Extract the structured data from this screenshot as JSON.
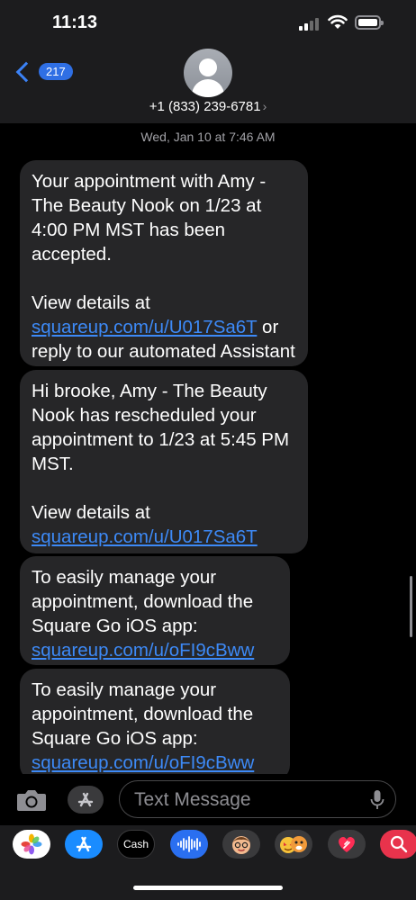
{
  "status": {
    "time": "11:13"
  },
  "nav": {
    "back_count": "217",
    "contact": "+1 (833) 239-6781",
    "arrow": "›"
  },
  "thread": {
    "timestamp": "Wed, Jan 10 at 7:46 AM",
    "messages": [
      {
        "text": "Your appointment with Amy - The Beauty Nook on 1/23 at 4:00 PM MST has been accepted.",
        "details_prefix": "View details at ",
        "link": "squareup.com/u/U017Sa6T",
        "suffix": " or reply to our automated Assistant"
      },
      {
        "text": "Hi brooke, Amy - The Beauty Nook has rescheduled your appointment to 1/23 at 5:45 PM MST.",
        "details_prefix": "View details at ",
        "link": "squareup.com/u/U017Sa6T"
      },
      {
        "text": "To easily manage your appointment, download the Square Go iOS app:",
        "link": "squareup.com/u/oFI9cBww"
      },
      {
        "text": "To easily manage your appointment, download the Square Go iOS app:",
        "link": "squareup.com/u/oFI9cBww"
      }
    ]
  },
  "composer": {
    "placeholder": "Text Message"
  },
  "apps": {
    "photos": "photos-icon",
    "app_store": "app-store-icon",
    "cash_label": "Cash",
    "audio": "audio-waveform-icon",
    "memoji": "memoji-icon",
    "animoji": "animoji-icon",
    "digital_touch": "digital-touch-icon",
    "search": "images-search-icon"
  },
  "colors": {
    "accent": "#3d8af7",
    "bubble": "#262628",
    "header": "#1c1c1e",
    "badge": "#2f6fe4"
  }
}
